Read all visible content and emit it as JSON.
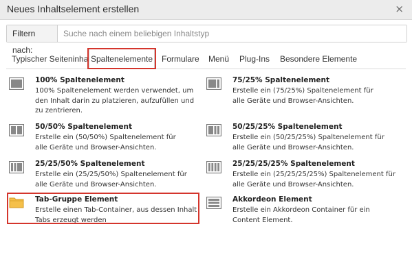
{
  "dialog": {
    "title": "Neues Inhaltselement erstellen",
    "close_symbol": "×"
  },
  "filter": {
    "label": "Filtern nach:",
    "placeholder": "Suche nach einem beliebigen Inhaltstyp",
    "value": ""
  },
  "tabs": [
    {
      "label": "Typischer Seiteninhalt",
      "active": false
    },
    {
      "label": "Spaltenelemente",
      "active": true
    },
    {
      "label": "Formulare",
      "active": false
    },
    {
      "label": "Menü",
      "active": false
    },
    {
      "label": "Plug-Ins",
      "active": false
    },
    {
      "label": "Besondere Elemente",
      "active": false
    }
  ],
  "elements": [
    {
      "title": "100% Spaltenelement",
      "description": "100% Spaltenelement werden verwendet, um den Inhalt darin zu platzieren, aufzufüllen und zu zentrieren.",
      "icon": "column-100-icon"
    },
    {
      "title": "75/25% Spaltenelement",
      "description": "Erstelle ein (75/25%) Spaltenelement für alle Geräte und Browser-Ansichten.",
      "icon": "column-75-25-icon"
    },
    {
      "title": "50/50% Spaltenelement",
      "description": "Erstelle ein (50/50%) Spaltenelement für alle Geräte und Browser-Ansichten.",
      "icon": "column-50-50-icon"
    },
    {
      "title": "50/25/25% Spaltenelement",
      "description": "Erstelle ein (50/25/25%) Spaltenelement für alle Geräte und Browser-Ansichten.",
      "icon": "column-50-25-25-icon"
    },
    {
      "title": "25/25/50% Spaltenelement",
      "description": "Erstelle ein (25/25/50%) Spaltenelement für alle Geräte und Browser-Ansichten.",
      "icon": "column-25-25-50-icon"
    },
    {
      "title": "25/25/25/25% Spaltenelement",
      "description": "Erstelle ein (25/25/25/25%) Spaltenelement für alle Geräte und Browser-Ansichten.",
      "icon": "column-25x4-icon"
    },
    {
      "title": "Tab-Gruppe Element",
      "description": "Erstelle einen Tab-Container, aus dessen Inhalt Tabs erzeugt werden",
      "icon": "folder-icon"
    },
    {
      "title": "Akkordeon Element",
      "description": "Erstelle ein Akkordeon Container für ein Content Element.",
      "icon": "accordion-icon"
    }
  ],
  "colors": {
    "highlight": "#d4352c",
    "folder": "#f5c04a",
    "icon_gray": "#777777"
  }
}
